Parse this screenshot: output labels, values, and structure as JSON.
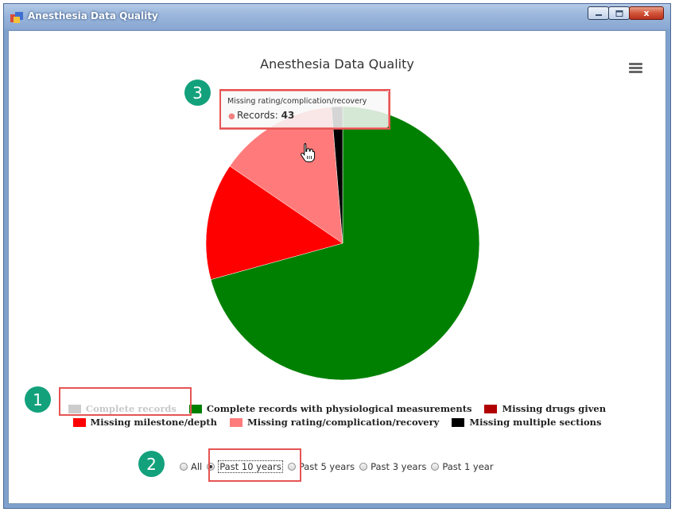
{
  "window": {
    "title": "Anesthesia Data Quality",
    "controls": {
      "minimize_icon": "minimize-icon",
      "maximize_icon": "maximize-icon",
      "close_label": "x"
    }
  },
  "chart": {
    "menu_icon": "hamburger-menu-icon",
    "tooltip": {
      "title": "Missing rating/complication/recovery",
      "series_label": "Records:",
      "value": "43"
    }
  },
  "chart_data": {
    "type": "pie",
    "title": "Anesthesia Data Quality",
    "legend_position": "bottom",
    "series": [
      {
        "name": "Complete records",
        "value": 0,
        "color": "#cccccc",
        "hidden": true
      },
      {
        "name": "Complete records with physiological measurements",
        "value": 215,
        "color": "#008000",
        "hidden": false
      },
      {
        "name": "Missing drugs given",
        "value": 0,
        "color": "#b00000",
        "hidden": false
      },
      {
        "name": "Missing milestone/depth",
        "value": 42,
        "color": "#ff0000",
        "hidden": false
      },
      {
        "name": "Missing rating/complication/recovery",
        "value": 43,
        "color": "#ff7b7b",
        "hidden": false
      },
      {
        "name": "Missing multiple sections",
        "value": 4,
        "color": "#000000",
        "hidden": false
      }
    ]
  },
  "time_filter": {
    "options": [
      "All",
      "Past 10 years",
      "Past 5 years",
      "Past 3 years",
      "Past 1 year"
    ],
    "selected": "Past 10 years"
  },
  "annotations": {
    "callout_1": "1",
    "callout_2": "2",
    "callout_3": "3",
    "highlight_color": "#e65454",
    "callout_color": "#13a17c"
  }
}
